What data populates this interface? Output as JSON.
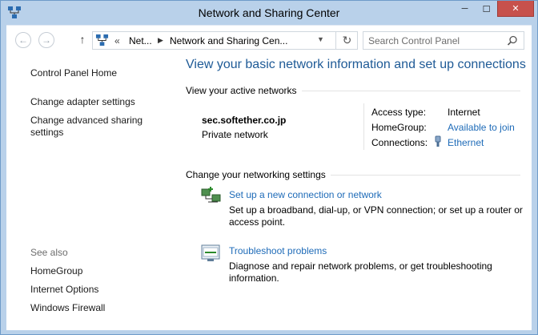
{
  "window": {
    "title": "Network and Sharing Center",
    "minimize_glyph": "─",
    "maximize_glyph": "☐",
    "close_glyph": "✕",
    "icon": "network-icon"
  },
  "address_bar": {
    "back_glyph": "←",
    "forward_glyph": "→",
    "up_glyph": "↑",
    "overflow_marker": "«",
    "crumbs": [
      "Net...",
      "Network and Sharing Cen..."
    ],
    "separator": "▶",
    "dropdown_glyph": "▼",
    "refresh_glyph": "↻"
  },
  "search": {
    "placeholder": "Search Control Panel"
  },
  "sidebar": {
    "home": "Control Panel Home",
    "links": [
      "Change adapter settings",
      "Change advanced sharing settings"
    ],
    "see_also_label": "See also",
    "see_also": [
      "HomeGroup",
      "Internet Options",
      "Windows Firewall"
    ]
  },
  "main": {
    "heading": "View your basic network information and set up connections",
    "active_networks_label": "View your active networks",
    "network": {
      "name": "sec.softether.co.jp",
      "type": "Private network",
      "access_type_label": "Access type:",
      "access_type_value": "Internet",
      "homegroup_label": "HomeGroup:",
      "homegroup_value": "Available to join",
      "connections_label": "Connections:",
      "connections_value": "Ethernet"
    },
    "change_settings_label": "Change your networking settings",
    "tasks": [
      {
        "title": "Set up a new connection or network",
        "description": "Set up a broadband, dial-up, or VPN connection; or set up a router or access point.",
        "icon": "new-connection-icon"
      },
      {
        "title": "Troubleshoot problems",
        "description": "Diagnose and repair network problems, or get troubleshooting information.",
        "icon": "troubleshoot-icon"
      }
    ]
  },
  "colors": {
    "frame": "#b9d1ea",
    "link": "#1e6bb8",
    "heading": "#1e5a96",
    "close_button": "#c7514c"
  }
}
